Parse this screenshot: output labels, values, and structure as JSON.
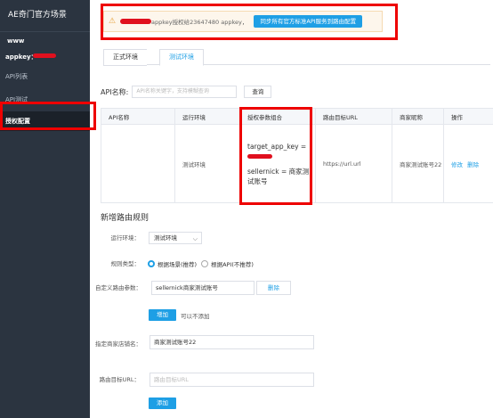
{
  "sidebar": {
    "brand": "AE奇门官方场景",
    "sub_title": "www",
    "appkey_label": "appkey：",
    "items": [
      {
        "label": "API列表"
      },
      {
        "label": "API测试"
      },
      {
        "label": "授权配置"
      }
    ]
  },
  "notice": {
    "text": "appkey授权给23647480 appkey，",
    "sync_button": "同步所有官方标准API服务到路由配置"
  },
  "tabs": [
    {
      "label": "正式环境"
    },
    {
      "label": "测试环境"
    }
  ],
  "search": {
    "label": "API名称:",
    "placeholder": "API名称关键字，支持模糊查询",
    "button": "查询"
  },
  "table": {
    "headers": [
      "API名称",
      "运行环境",
      "授权参数组合",
      "路由目标URL",
      "商家昵称",
      "操作"
    ],
    "row": {
      "api_name": "",
      "env": "测试环境",
      "param_1": "target_app_key =",
      "param_2": "sellernick = 商家测试账号",
      "url": "https://url.url",
      "nick": "商家测试账号22",
      "edit": "修改",
      "delete": "删除"
    }
  },
  "form": {
    "title": "新增路由规则",
    "env_label": "运行环境：",
    "env_value": "测试环境",
    "rule_label": "规则类型：",
    "rule_option_1": "根据场景(推荐)",
    "rule_option_2": "根据API(不推荐)",
    "custom_label": "自定义路由参数：",
    "custom_value": "sellernick商家测试账号",
    "custom_delete": "删除",
    "add_param": "增加",
    "add_note": "可以不添加",
    "shop_label": "指定商家店铺名：",
    "shop_value": "商家测试账号22",
    "url_label": "路由目标URL：",
    "url_placeholder": "路由目标URL",
    "submit": "添加"
  }
}
